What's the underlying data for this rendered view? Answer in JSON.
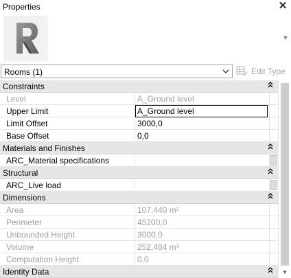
{
  "panel": {
    "title": "Properties",
    "close_glyph": "✕",
    "logo_icon": "revit-r-logo",
    "logo_color": "#7c7c7c"
  },
  "type_selector": {
    "selected": "Rooms (1)",
    "edit_type_label": "Edit Type"
  },
  "groups": [
    {
      "name": "Constraints",
      "properties": [
        {
          "name": "Level",
          "value": "A_Ground level",
          "readonly": true
        },
        {
          "name": "Upper Limit",
          "value": "A_Ground level",
          "readonly": false,
          "editing": true
        },
        {
          "name": "Limit Offset",
          "value": "3000,0",
          "readonly": false
        },
        {
          "name": "Base Offset",
          "value": "0,0",
          "readonly": false
        }
      ]
    },
    {
      "name": "Materials and Finishes",
      "properties": [
        {
          "name": "ARC_Material specifications",
          "value": "",
          "readonly": false,
          "side_button": true
        }
      ]
    },
    {
      "name": "Structural",
      "properties": [
        {
          "name": "ARC_Live load",
          "value": "",
          "readonly": false,
          "side_button": true
        }
      ]
    },
    {
      "name": "Dimensions",
      "properties": [
        {
          "name": "Area",
          "value": "107,440 m²",
          "readonly": true
        },
        {
          "name": "Perimeter",
          "value": "45200,0",
          "readonly": true
        },
        {
          "name": "Unbounded Height",
          "value": "3000,0",
          "readonly": true
        },
        {
          "name": "Volume",
          "value": "252,484 m³",
          "readonly": true
        },
        {
          "name": "Computation Height",
          "value": "0,0",
          "readonly": true
        }
      ]
    },
    {
      "name": "Identity Data",
      "properties": []
    }
  ],
  "collapse_glyph": "⌃⌃"
}
